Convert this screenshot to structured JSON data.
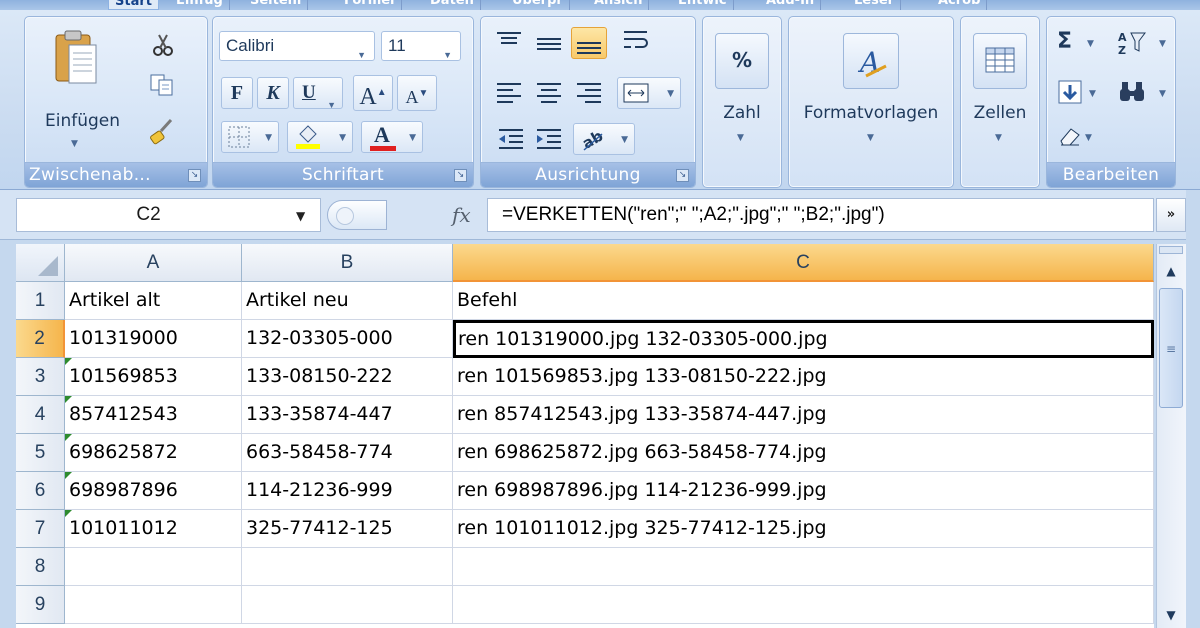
{
  "ribbon_tabs": [
    "Start",
    "Einfüg",
    "Seitenl",
    "Formel",
    "Daten",
    "Überpr",
    "Ansich",
    "Entwic",
    "Add-In",
    "Leser",
    "Acrob"
  ],
  "clipboard": {
    "paste_label": "Einfügen",
    "group_label": "Zwischenab...",
    "cut_icon": "scissors-icon",
    "copy_icon": "copy-icon",
    "format_painter_icon": "brush-icon"
  },
  "font": {
    "name": "Calibri",
    "size": "11",
    "bold": "F",
    "italic": "K",
    "underline": "U",
    "grow": "A",
    "shrink": "A",
    "font_color_letter": "A",
    "group_label": "Schriftart",
    "highlight_color": "#ffff00",
    "text_color": "#e02020"
  },
  "alignment": {
    "group_label": "Ausrichtung"
  },
  "number": {
    "percent": "%",
    "label": "Zahl"
  },
  "styles": {
    "label": "Formatvorlagen"
  },
  "cells_group": {
    "label": "Zellen"
  },
  "editing": {
    "sum": "Σ",
    "group_label": "Bearbeiten"
  },
  "formula_bar": {
    "name_box": "C2",
    "fx": "fx",
    "formula": "=VERKETTEN(\"ren\";\" \";A2;\".jpg\";\" \";B2;\".jpg\")",
    "expand": "»"
  },
  "sheet": {
    "columns": [
      "A",
      "B",
      "C"
    ],
    "selected_column": "C",
    "row_numbers": [
      "1",
      "2",
      "3",
      "4",
      "5",
      "6",
      "7",
      "8",
      "9"
    ],
    "selected_row": "2",
    "rows": [
      [
        "Artikel alt",
        "Artikel neu",
        "Befehl"
      ],
      [
        "101319000",
        "132-03305-000",
        "ren 101319000.jpg 132-03305-000.jpg"
      ],
      [
        "101569853",
        "133-08150-222",
        "ren 101569853.jpg 133-08150-222.jpg"
      ],
      [
        "857412543",
        "133-35874-447",
        "ren 857412543.jpg 133-35874-447.jpg"
      ],
      [
        "698625872",
        "663-58458-774",
        "ren 698625872.jpg 663-58458-774.jpg"
      ],
      [
        "698987896",
        "114-21236-999",
        "ren 698987896.jpg 114-21236-999.jpg"
      ],
      [
        "101011012",
        "325-77412-125",
        "ren 101011012.jpg 325-77412-125.jpg"
      ],
      [
        "",
        "",
        ""
      ],
      [
        "",
        "",
        ""
      ]
    ]
  },
  "colors": {
    "selection_header": "#f5b54c",
    "error_flag": "#2e8b2e",
    "ribbon_label": "#7fa4d6"
  }
}
